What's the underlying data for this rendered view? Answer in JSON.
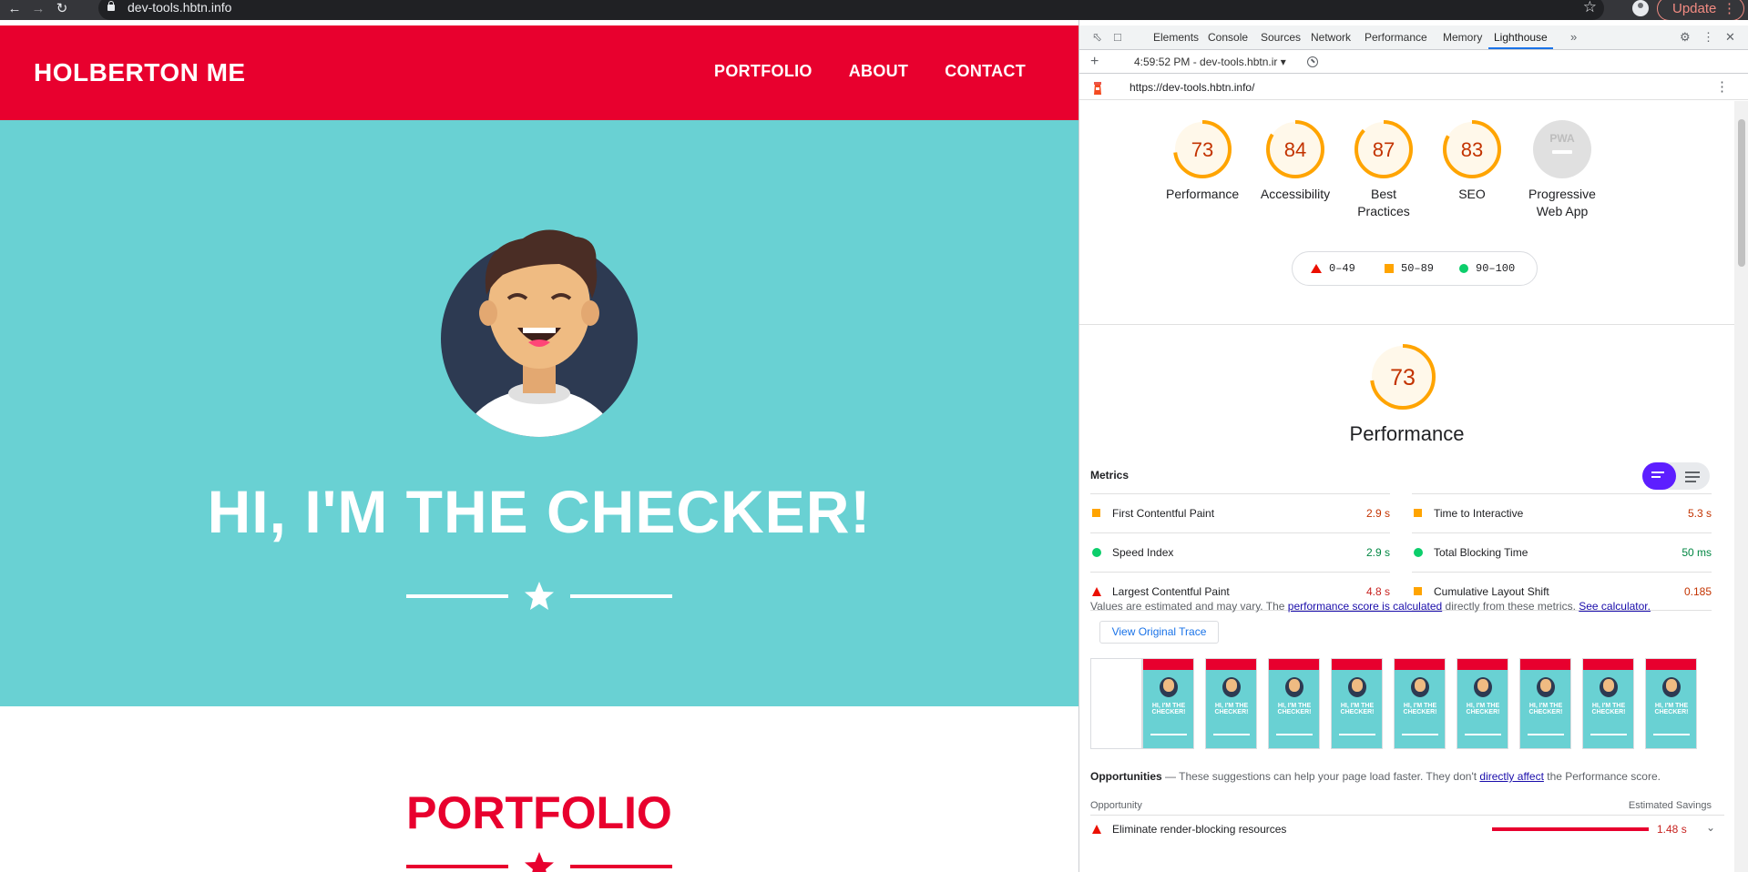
{
  "browser": {
    "url": "dev-tools.hbtn.info",
    "update_label": "Update"
  },
  "site": {
    "brand": "HOLBERTON ME",
    "nav": [
      "PORTFOLIO",
      "ABOUT",
      "CONTACT"
    ],
    "hero_title": "HI, I'M THE CHECKER!",
    "portfolio_title": "PORTFOLIO"
  },
  "devtools": {
    "tabs": [
      "Elements",
      "Console",
      "Sources",
      "Network",
      "Performance",
      "Memory",
      "Lighthouse"
    ],
    "active_tab": "Lighthouse",
    "report_label": "4:59:52 PM - dev-tools.hbtn.ir",
    "report_url": "https://dev-tools.hbtn.info/"
  },
  "lighthouse": {
    "scores": [
      {
        "label": "Performance",
        "value": 73
      },
      {
        "label": "Accessibility",
        "value": 84
      },
      {
        "label": "Best\nPractices",
        "value": 87
      },
      {
        "label": "SEO",
        "value": 83
      },
      {
        "label": "Progressive\nWeb App",
        "value": null,
        "badge": "PWA"
      }
    ],
    "legend": [
      "0–49",
      "50–89",
      "90–100"
    ],
    "perf_score": 73,
    "perf_title": "Performance",
    "metrics_title": "Metrics",
    "metrics": [
      {
        "name": "First Contentful Paint",
        "value": "2.9 s",
        "status": "average"
      },
      {
        "name": "Time to Interactive",
        "value": "5.3 s",
        "status": "average"
      },
      {
        "name": "Speed Index",
        "value": "2.9 s",
        "status": "pass"
      },
      {
        "name": "Total Blocking Time",
        "value": "50 ms",
        "status": "pass"
      },
      {
        "name": "Largest Contentful Paint",
        "value": "4.8 s",
        "status": "fail"
      },
      {
        "name": "Cumulative Layout Shift",
        "value": "0.185",
        "status": "average"
      }
    ],
    "note": {
      "prefix": "Values are estimated and may vary. The ",
      "link1": "performance score is calculated",
      "middle": " directly from these metrics. ",
      "link2": "See calculator."
    },
    "trace_button": "View Original Trace",
    "thumb_text": "HI, I'M THE CHECKER!",
    "opportunities": {
      "title": "Opportunities",
      "desc_prefix": " — These suggestions can help your page load faster. They don't ",
      "desc_link": "directly affect",
      "desc_suffix": " the Performance score.",
      "col_left": "Opportunity",
      "col_right": "Estimated Savings",
      "items": [
        {
          "name": "Eliminate render-blocking resources",
          "value": "1.48 s",
          "fill": 1.0
        }
      ]
    }
  },
  "colors": {
    "brand_red": "#e8002e",
    "hero_teal": "#69d1d3",
    "score_orange": "#ffa400",
    "score_green": "#0cce6b",
    "score_red": "#eb0f00",
    "toggle_purple": "#5d1eff"
  }
}
